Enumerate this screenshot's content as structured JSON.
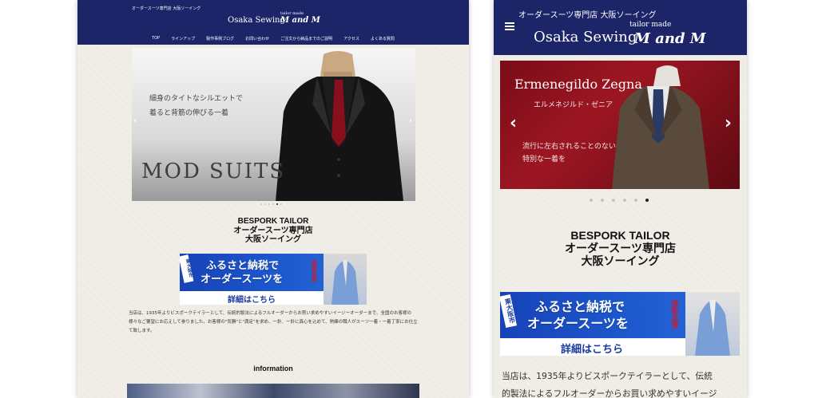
{
  "desktop": {
    "tagline": "オーダースーツ専門店 大阪ソーイング",
    "logo_main": "Osaka Sewing",
    "logo_small": "tailor made",
    "logo_script": "M and M",
    "nav": [
      "TOP",
      "ラインアップ",
      "製作事例ブログ",
      "お問い合わせ",
      "ご注文から納品までのご説明",
      "アクセス",
      "よくある質問"
    ],
    "slide": {
      "line1": "細身のタイトなシルエットで",
      "line2": "着ると背筋の伸びる一着",
      "caption": "MOD SUITS",
      "dot_count": 6,
      "active_dot": 4
    },
    "title": [
      "BESPORK TAILOR",
      "オーダースーツ専門店",
      "大阪ソーイング"
    ],
    "banner": {
      "tag": "東大阪市",
      "line1": "ふるさと納税で",
      "line2": "オーダースーツを",
      "line3": "詳細はこちら",
      "badge": "感動品質"
    },
    "body": "当店は、1935年よりビスポークテイラーとして、伝統的製法によるフルオーダーからお買い求めやすいイージーオーダーまで、全国のお客様の様々なご要望にお応えして参りました。お客様の\"気勝\"と\"満足\"を求め、一針、一針に真心を込めて、熟練の職人がスーツ一着・一着丁寧にお仕立て致します。",
    "section": "information"
  },
  "mobile": {
    "tagline": "オーダースーツ専門店 大阪ソーイング",
    "logo_main": "Osaka Sewing",
    "logo_small": "tailor made",
    "logo_script": "M and M",
    "menu_icon": "hamburger-icon",
    "slide": {
      "brand": "Ermenegildo Zegna",
      "brand_jp": "エルメネジルド・ゼニア",
      "line1": "流行に左右されることのない",
      "line2": "特別な一着を",
      "dot_count": 6,
      "active_dot": 5
    },
    "title": [
      "BESPORK TAILOR",
      "オーダースーツ専門店",
      "大阪ソーイング"
    ],
    "banner": {
      "tag": "東大阪市",
      "line1": "ふるさと納税で",
      "line2": "オーダースーツを",
      "line3": "詳細はこちら",
      "badge": "感動品質"
    },
    "body_line1": "当店は、1935年よりビスポークテイラーとして、伝統",
    "body_line2": "的製法によるフルオーダーからお買い求めやすいイージ"
  },
  "colors": {
    "header": "#1b2567",
    "page_bg": "#efece5",
    "banner_blue": "#1e5bd0",
    "accent_red": "#c0203a"
  }
}
